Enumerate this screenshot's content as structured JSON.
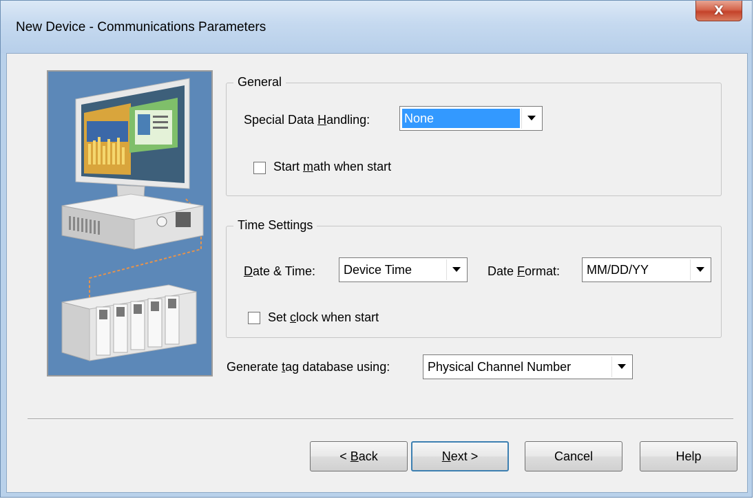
{
  "window": {
    "title": "New Device - Communications Parameters",
    "close_glyph": "X"
  },
  "general": {
    "legend": "General",
    "special_data_handling": {
      "label_pre": "Special Data ",
      "label_accel": "H",
      "label_post": "andling:",
      "value": "None"
    },
    "start_math": {
      "label_pre": "Start ",
      "label_accel": "m",
      "label_post": "ath when start",
      "checked": false
    }
  },
  "time_settings": {
    "legend": "Time Settings",
    "date_time": {
      "label_accel": "D",
      "label_post": "ate & Time:",
      "value": "Device Time"
    },
    "date_format": {
      "label_pre": "Date ",
      "label_accel": "F",
      "label_post": "ormat:",
      "value": "MM/DD/YY"
    },
    "set_clock": {
      "label_pre": "Set ",
      "label_accel": "c",
      "label_post": "lock when start",
      "checked": false
    }
  },
  "generate_tag": {
    "label_pre": "Generate ",
    "label_accel": "t",
    "label_post": "ag database using:",
    "value": "Physical Channel Number"
  },
  "buttons": {
    "back": {
      "pre": "< ",
      "accel": "B",
      "post": "ack"
    },
    "next": {
      "accel": "N",
      "post": "ext >"
    },
    "cancel": "Cancel",
    "help": "Help"
  }
}
